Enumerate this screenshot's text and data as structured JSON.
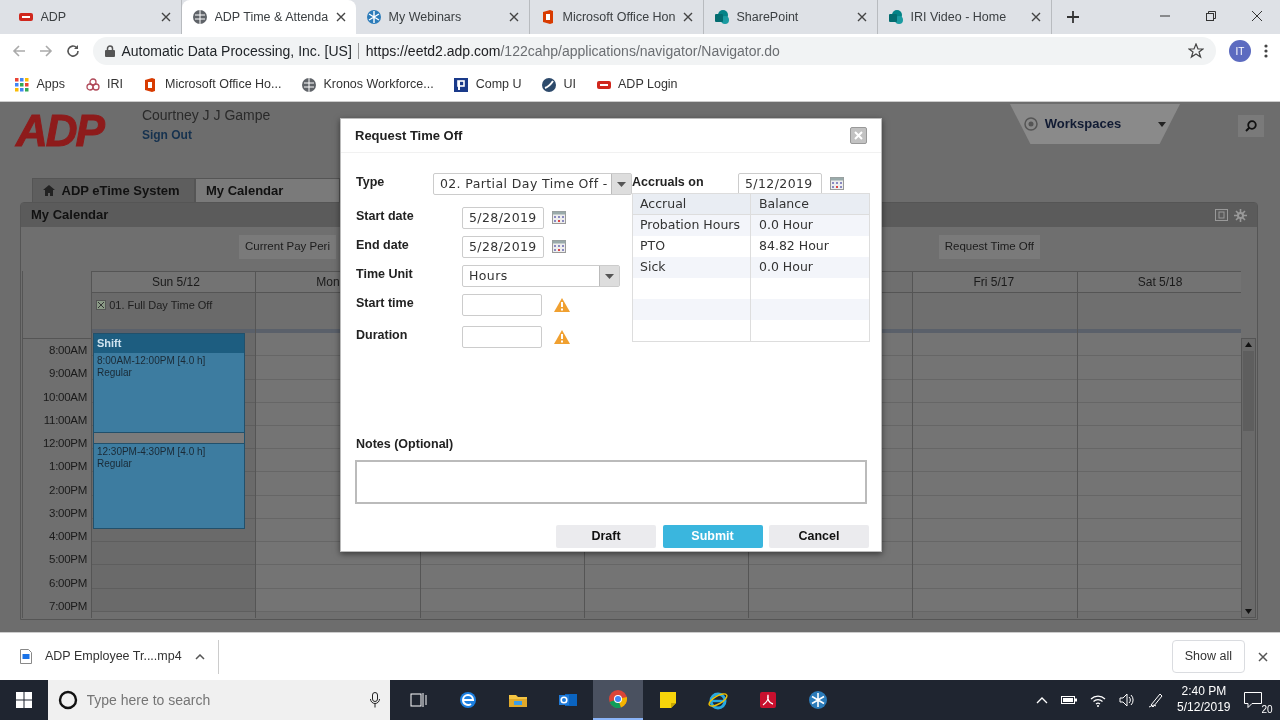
{
  "browser": {
    "tabs": [
      {
        "title": "ADP",
        "kind": "adp",
        "selected": false
      },
      {
        "title": "ADP Time & Attenda",
        "kind": "globe",
        "selected": true
      },
      {
        "title": "My Webinars",
        "kind": "webinar",
        "selected": false
      },
      {
        "title": "Microsoft Office Hon",
        "kind": "office",
        "selected": false
      },
      {
        "title": "SharePoint",
        "kind": "sharepoint",
        "selected": false
      },
      {
        "title": "IRI Video - Home",
        "kind": "sharepoint",
        "selected": false
      }
    ],
    "site_name": "Automatic Data Processing, Inc. [US]",
    "url_host": "https://eetd2.adp.com",
    "url_path": "/122cahp/applications/navigator/Navigator.do",
    "profile": "IT",
    "bookmarks": [
      {
        "label": "Apps",
        "kind": "apps"
      },
      {
        "label": "IRI",
        "kind": "iri"
      },
      {
        "label": "Microsoft Office Ho...",
        "kind": "office"
      },
      {
        "label": "Kronos Workforce...",
        "kind": "globe"
      },
      {
        "label": "Comp U",
        "kind": "p"
      },
      {
        "label": "UI",
        "kind": "ui"
      },
      {
        "label": "ADP Login",
        "kind": "adp"
      }
    ]
  },
  "app": {
    "logo": "ADP",
    "user": "Courtney J J Gampe",
    "sign_out": "Sign Out",
    "workspaces": "Workspaces",
    "tabs": [
      {
        "label": "ADP eTime System",
        "selected": false
      },
      {
        "label": "My Calendar",
        "selected": true
      }
    ],
    "panel_title": "My Calendar",
    "toolbar": [
      {
        "label": "Current Pay Peri"
      },
      {
        "label": "Request Time Off"
      }
    ],
    "calendar": {
      "days_left": [
        {
          "label": "Sun 5/12",
          "all_day": "01. Full Day Time Off",
          "shift": {
            "title": "Shift",
            "segments": [
              {
                "time": "8:00AM-12:00PM [4.0 h]",
                "type": "Regular"
              },
              {
                "time": "12:30PM-4:30PM [4.0 h]",
                "type": "Regular"
              }
            ]
          }
        },
        {
          "label": "Mon"
        }
      ],
      "days_right": [
        {
          "label": "Fri 5/17"
        },
        {
          "label": "Sat 5/18"
        }
      ],
      "times": [
        "8:00AM",
        "9:00AM",
        "10:00AM",
        "11:00AM",
        "12:00PM",
        "1:00PM",
        "2:00PM",
        "3:00PM",
        "4:00PM",
        "5:00PM",
        "6:00PM",
        "7:00PM"
      ]
    }
  },
  "dialog": {
    "title": "Request Time Off",
    "fields": [
      {
        "label": "Type",
        "kind": "select",
        "value": "02. Partial Day Time Off -",
        "warning": false
      },
      {
        "label": "Start date",
        "kind": "date",
        "value": "5/28/2019",
        "warning": false
      },
      {
        "label": "End date",
        "kind": "date",
        "value": "5/28/2019",
        "warning": false
      },
      {
        "label": "Time Unit",
        "kind": "select-wide",
        "value": "Hours",
        "warning": false
      },
      {
        "label": "Start time",
        "kind": "text",
        "warning": true
      },
      {
        "label": "Duration",
        "kind": "text",
        "warning": true
      }
    ],
    "accruals_label": "Accruals on",
    "accruals_date": "5/12/2019",
    "accruals": {
      "columns": [
        "Accrual",
        "Balance"
      ],
      "rows": [
        [
          "Probation Hours",
          "0.0 Hour"
        ],
        [
          "PTO",
          "84.82 Hour"
        ],
        [
          "Sick",
          "0.0 Hour"
        ]
      ]
    },
    "notes_label": "Notes (Optional)",
    "buttons": [
      {
        "label": "Draft",
        "primary": false
      },
      {
        "label": "Submit",
        "primary": true
      },
      {
        "label": "Cancel",
        "primary": false
      }
    ]
  },
  "downloads": {
    "file": "ADP Employee Tr....mp4",
    "show_all": "Show all"
  },
  "taskbar": {
    "search_placeholder": "Type here to search",
    "apps": [
      {
        "kind": "taskview",
        "active": false
      },
      {
        "kind": "edge",
        "active": false
      },
      {
        "kind": "folder",
        "active": false
      },
      {
        "kind": "outlook",
        "active": false
      },
      {
        "kind": "chrome",
        "active": true
      },
      {
        "kind": "notes",
        "active": false
      },
      {
        "kind": "ie",
        "active": false
      },
      {
        "kind": "pdf",
        "active": false
      },
      {
        "kind": "snow",
        "active": false
      }
    ],
    "time": "2:40 PM",
    "date": "5/12/2019",
    "notifications": "20"
  }
}
